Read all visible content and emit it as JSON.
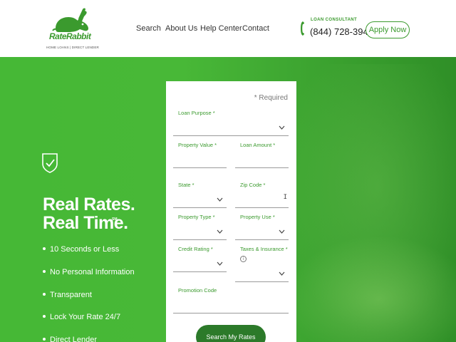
{
  "brand": {
    "name": "RateRabbit",
    "tagline": "HOME LOANS | DIRECT LENDER",
    "color": "#3b9a2e"
  },
  "nav": {
    "items": [
      {
        "label": "Search"
      },
      {
        "label": "About Us"
      },
      {
        "label": "Help Center"
      },
      {
        "label": "Contact"
      }
    ]
  },
  "contact": {
    "label": "LOAN CONSULTANT",
    "phone": "(844) 728-3948",
    "icon": "phone-icon"
  },
  "apply_button": "Apply Now",
  "hero": {
    "title_line1": "Real Rates.",
    "title_line2": "Real Time.",
    "title_mark": "SM",
    "features": [
      "10 Seconds or Less",
      "No Personal Information",
      "Transparent",
      "Lock Your Rate 24/7",
      "Direct Lender"
    ]
  },
  "form": {
    "required_note": "* Required",
    "fields": {
      "loan_purpose": "Loan Purpose *",
      "property_value": "Property Value *",
      "loan_amount": "Loan Amount *",
      "state": "State *",
      "zip_code": "Zip Code *",
      "property_type": "Property Type *",
      "property_use": "Property Use *",
      "credit_rating": "Credit Rating *",
      "taxes_insurance": "Taxes & Insurance *",
      "promotion_code": "Promotion Code"
    },
    "submit_label": "Search My Rates"
  }
}
